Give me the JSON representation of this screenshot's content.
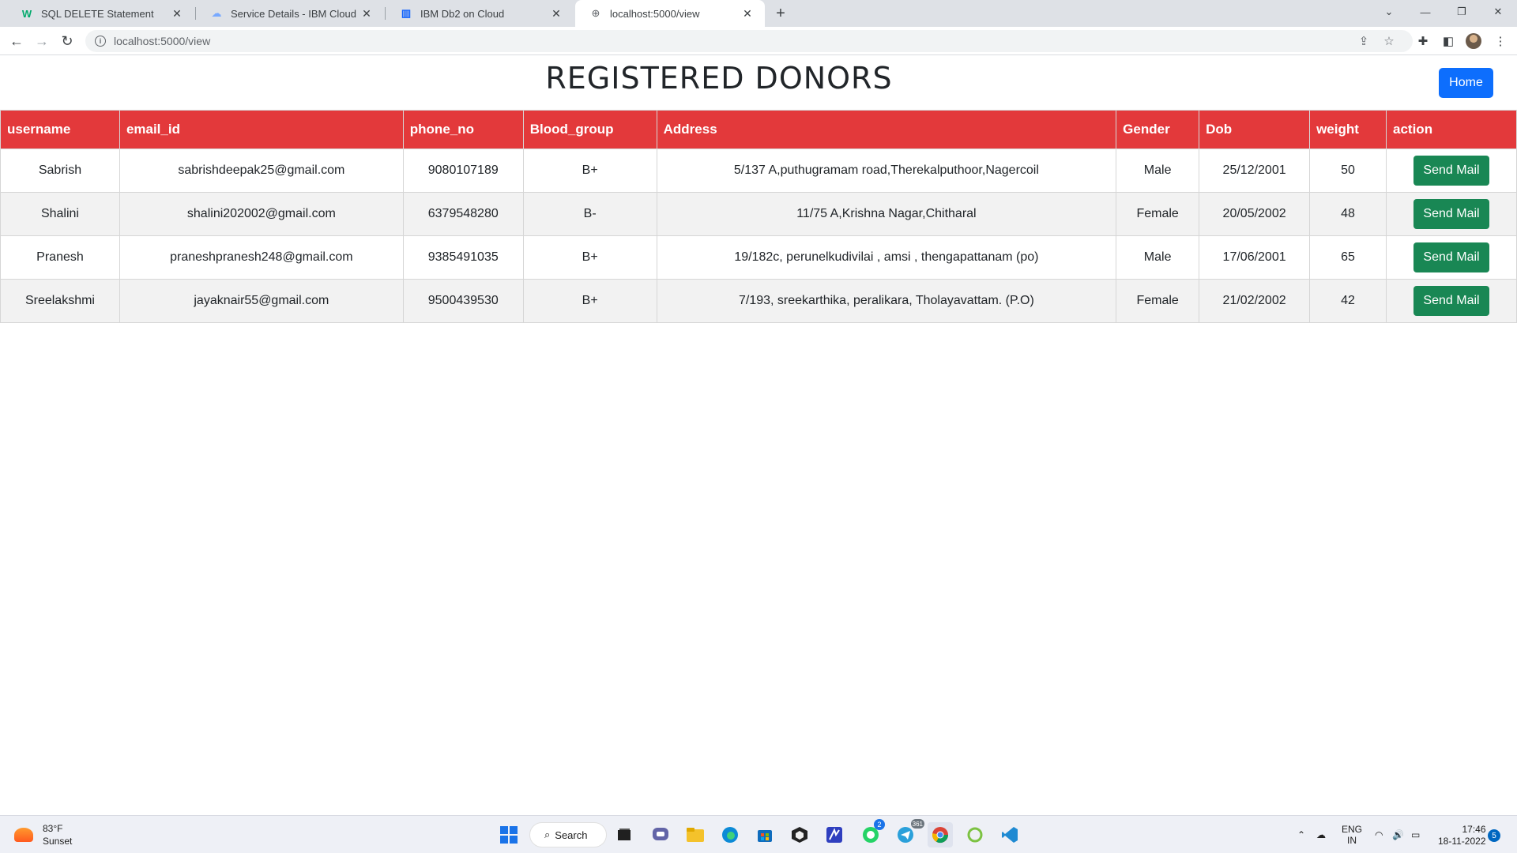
{
  "browser": {
    "tabs": [
      {
        "label": "SQL DELETE Statement",
        "icon": "w3schools-icon"
      },
      {
        "label": "Service Details - IBM Cloud",
        "icon": "cloud-icon"
      },
      {
        "label": "IBM Db2 on Cloud",
        "icon": "db2-icon"
      },
      {
        "label": "localhost:5000/view",
        "icon": "globe-icon"
      }
    ],
    "url": "localhost:5000/view"
  },
  "page": {
    "title": "REGISTERED DONORS",
    "home_label": "Home"
  },
  "table": {
    "columns": [
      "username",
      "email_id",
      "phone_no",
      "Blood_group",
      "Address",
      "Gender",
      "Dob",
      "weight",
      "action"
    ],
    "rows": [
      {
        "username": "Sabrish",
        "email_id": "sabrishdeepak25@gmail.com",
        "phone_no": "9080107189",
        "blood_group": "B+",
        "address": "5/137 A,puthugramam road,Therekalputhoor,Nagercoil",
        "gender": "Male",
        "dob": "25/12/2001",
        "weight": "50",
        "action": "Send Mail"
      },
      {
        "username": "Shalini",
        "email_id": "shalini202002@gmail.com",
        "phone_no": "6379548280",
        "blood_group": "B-",
        "address": "11/75 A,Krishna Nagar,Chitharal",
        "gender": "Female",
        "dob": "20/05/2002",
        "weight": "48",
        "action": "Send Mail"
      },
      {
        "username": "Pranesh",
        "email_id": "praneshpranesh248@gmail.com",
        "phone_no": "9385491035",
        "blood_group": "B+",
        "address": "19/182c, perunelkudivilai , amsi , thengapattanam (po)",
        "gender": "Male",
        "dob": "17/06/2001",
        "weight": "65",
        "action": "Send Mail"
      },
      {
        "username": "Sreelakshmi",
        "email_id": "jayaknair55@gmail.com",
        "phone_no": "9500439530",
        "blood_group": "B+",
        "address": "7/193, sreekarthika, peralikara, Tholayavattam. (P.O)",
        "gender": "Female",
        "dob": "21/02/2002",
        "weight": "42",
        "action": "Send Mail"
      }
    ]
  },
  "taskbar": {
    "weather_temp": "83°F",
    "weather_desc": "Sunset",
    "search_label": "Search",
    "whatsapp_badge": "2",
    "telegram_badge": "361",
    "lang_line1": "ENG",
    "lang_line2": "IN",
    "time": "17:46",
    "date": "18-11-2022",
    "notification_count": "5"
  },
  "colors": {
    "header_red": "#e3393b",
    "home_blue": "#0d6efd",
    "send_green": "#198754"
  }
}
